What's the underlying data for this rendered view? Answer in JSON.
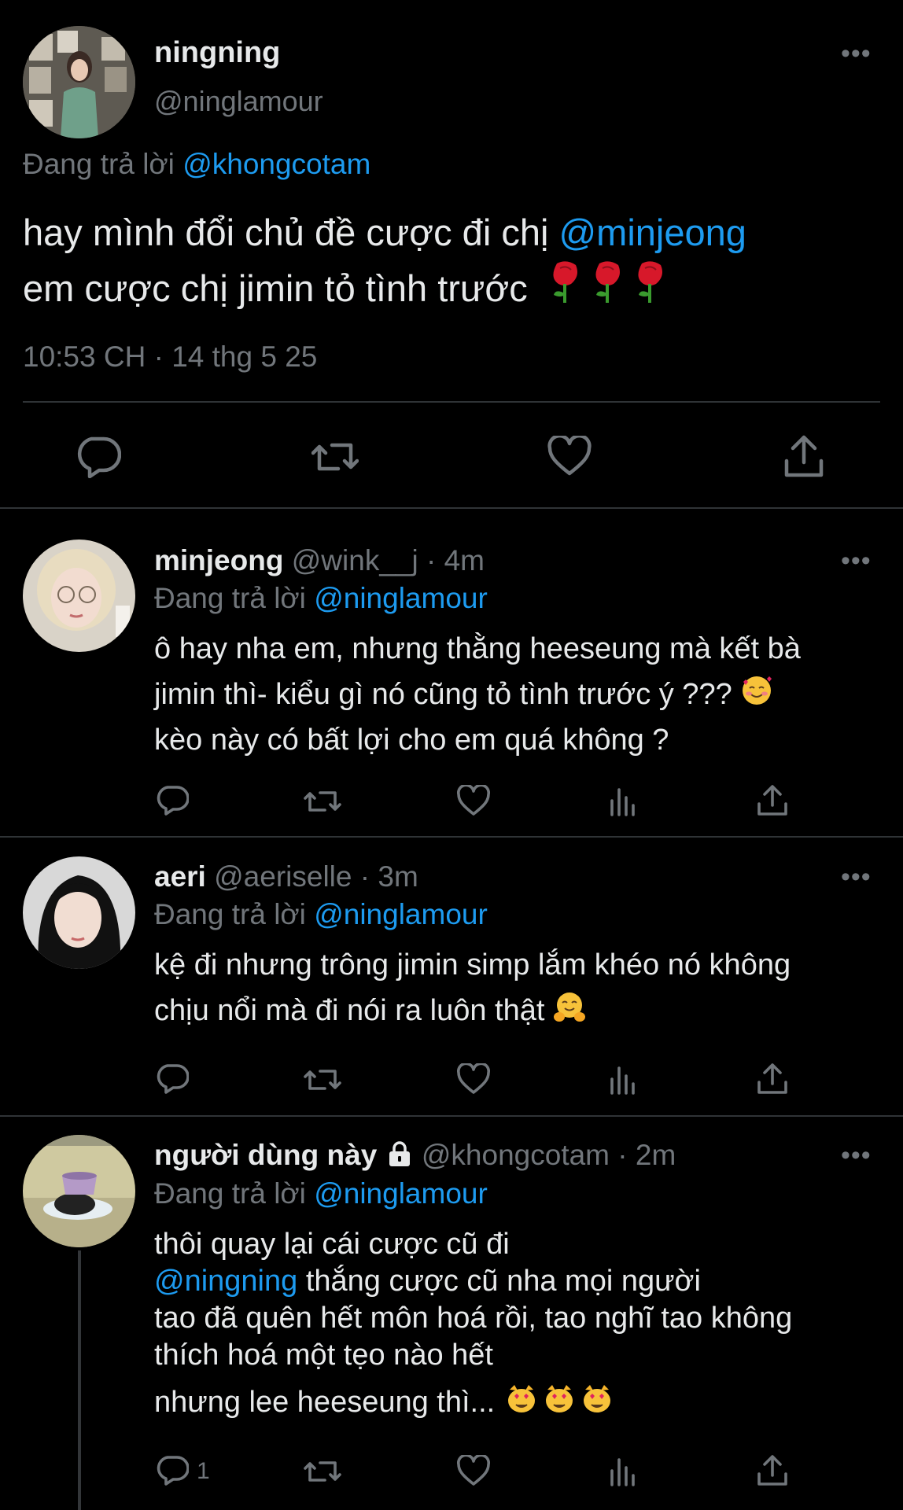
{
  "main_tweet": {
    "author_name": "ningning",
    "author_handle": "@ninglamour",
    "replying_prefix": "Đang trả lời",
    "replying_to": "@khongcotam",
    "text_part1": "hay mình đổi chủ đề cược đi chị",
    "mention": "@minjeong",
    "text_part2": "em cược chị jimin tỏ tình trước",
    "timestamp": "10:53 CH · 14 thg 5 25",
    "more_icon": "more-horizontal-icon",
    "actions": [
      "reply-icon",
      "retweet-icon",
      "like-icon",
      "share-icon"
    ]
  },
  "replies": [
    {
      "name": "minjeong",
      "handle": "@wink__j",
      "time": "· 4m",
      "replying_prefix": "Đang trả lời",
      "replying_to": "@ninglamour",
      "line1": "ô hay nha em, nhưng thằng heeseung mà kết bà",
      "line2": "jimin thì- kiểu gì nó cũng tỏ tình trước ý ???",
      "line3": "kèo này có bất lợi cho em quá không ?"
    },
    {
      "name": "aeri",
      "handle": "@aeriselle",
      "time": "· 3m",
      "replying_prefix": "Đang trả lời",
      "replying_to": "@ninglamour",
      "line1": "kệ đi nhưng trông jimin simp lắm khéo nó không",
      "line2": "chịu nổi mà đi nói ra luôn thật"
    },
    {
      "name": "người dùng này",
      "handle": "@khongcotam",
      "time": "· 2m",
      "replying_prefix": "Đang trả lời",
      "replying_to": "@ninglamour",
      "line1": "thôi quay lại cái cược cũ đi",
      "mention": "@ningning",
      "line2_rest": " thắng cược cũ nha mọi người",
      "line3": "tao đã quên hết môn hoá rồi, tao nghĩ tao không",
      "line4": "thích hoá một tẹo nào hết",
      "line5": "nhưng lee heeseung thì...",
      "reply_count": "1"
    }
  ],
  "colors": {
    "background": "#000000",
    "text": "#e7e9ea",
    "muted": "#71767b",
    "link": "#1d9bf0",
    "divider": "#2f3336"
  }
}
